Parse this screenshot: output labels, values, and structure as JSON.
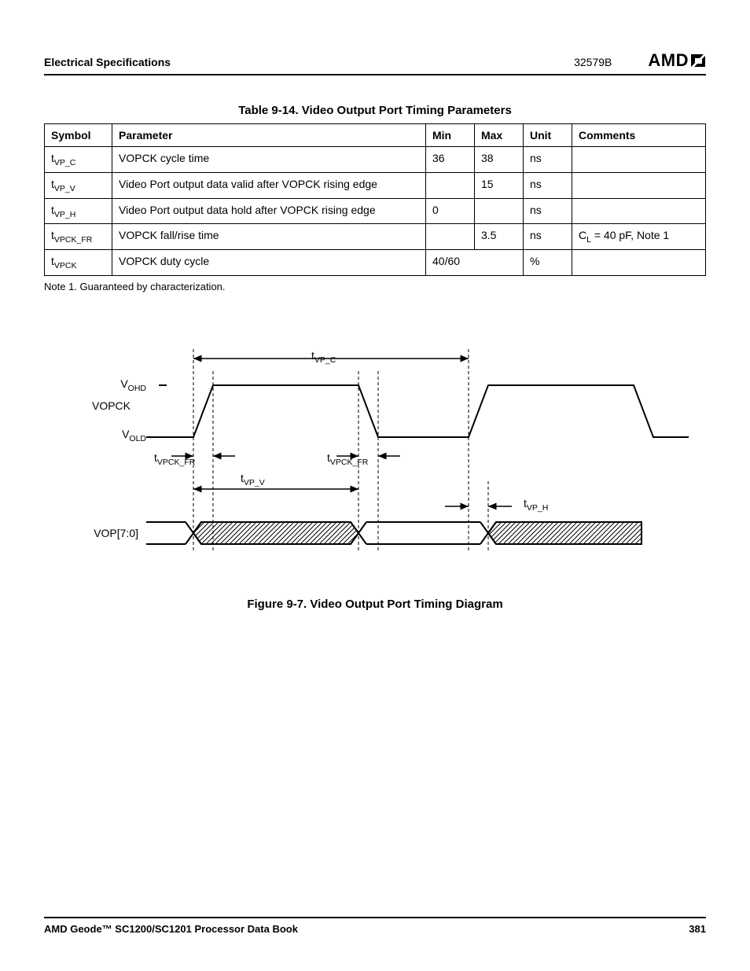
{
  "header": {
    "section": "Electrical Specifications",
    "code": "32579B",
    "brand": "AMD"
  },
  "table": {
    "caption": "Table 9-14.  Video Output Port Timing Parameters",
    "headers": {
      "symbol": "Symbol",
      "parameter": "Parameter",
      "min": "Min",
      "max": "Max",
      "unit": "Unit",
      "comments": "Comments"
    },
    "rows": [
      {
        "sym_pre": "t",
        "sym_sub": "VP_C",
        "param": "VOPCK cycle time",
        "min": "36",
        "max": "38",
        "unit": "ns",
        "comments": ""
      },
      {
        "sym_pre": "t",
        "sym_sub": "VP_V",
        "param": "Video Port output data valid after VOPCK rising edge",
        "min": "",
        "max": "15",
        "unit": "ns",
        "comments": ""
      },
      {
        "sym_pre": "t",
        "sym_sub": "VP_H",
        "param": "Video Port output data hold after VOPCK rising edge",
        "min": "0",
        "max": "",
        "unit": "ns",
        "comments": ""
      },
      {
        "sym_pre": "t",
        "sym_sub": "VPCK_FR",
        "param": "VOPCK fall/rise time",
        "min": "",
        "max": "3.5",
        "unit": "ns",
        "comments_html": "C<sub>L</sub> = 40 pF, Note 1"
      },
      {
        "sym_pre": "t",
        "sym_sub": "VPCK",
        "param": "VOPCK duty cycle",
        "minmax": "40/60",
        "unit": "%",
        "comments": ""
      }
    ],
    "note": "Note 1.   Guaranteed by characterization."
  },
  "figure": {
    "caption": "Figure 9-7.  Video Output Port Timing Diagram",
    "labels": {
      "t_vp_c": "VP_C",
      "t_vpck_fr": "VPCK_FR",
      "t_vp_v": "VP_V",
      "t_vp_h": "VP_H",
      "vohd": "OHD",
      "vold": "OLD",
      "vopck": "VOPCK",
      "vop": "VOP[7:0]"
    }
  },
  "footer": {
    "book": "AMD Geode™ SC1200/SC1201 Processor Data Book",
    "page": "381"
  }
}
